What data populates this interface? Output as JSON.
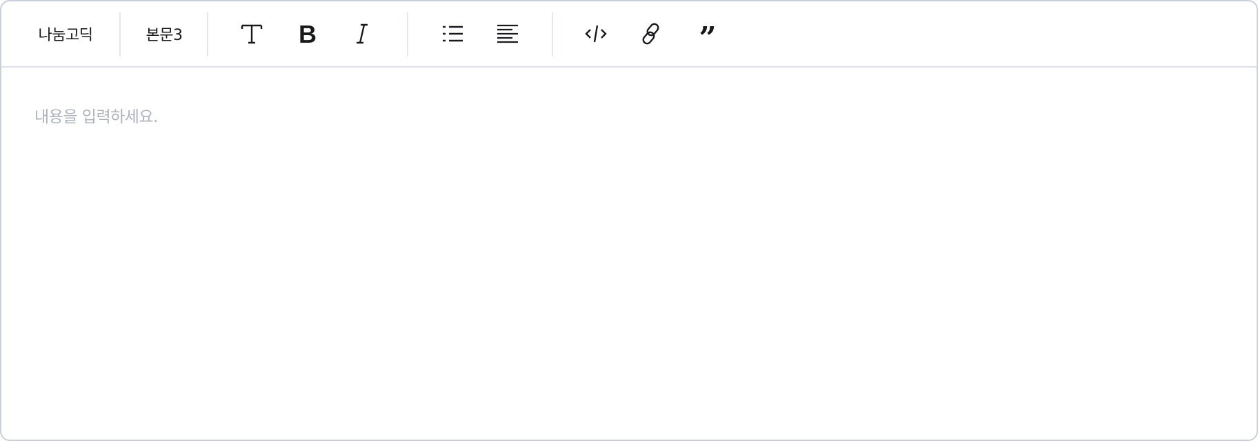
{
  "toolbar": {
    "font_family": "나눔고딕",
    "text_style": "본문3",
    "icons": [
      "text-size-icon",
      "bold-icon",
      "italic-icon",
      "bullet-list-icon",
      "align-left-icon",
      "code-icon",
      "link-icon",
      "quote-icon"
    ]
  },
  "editor": {
    "placeholder": "내용을 입력하세요."
  }
}
